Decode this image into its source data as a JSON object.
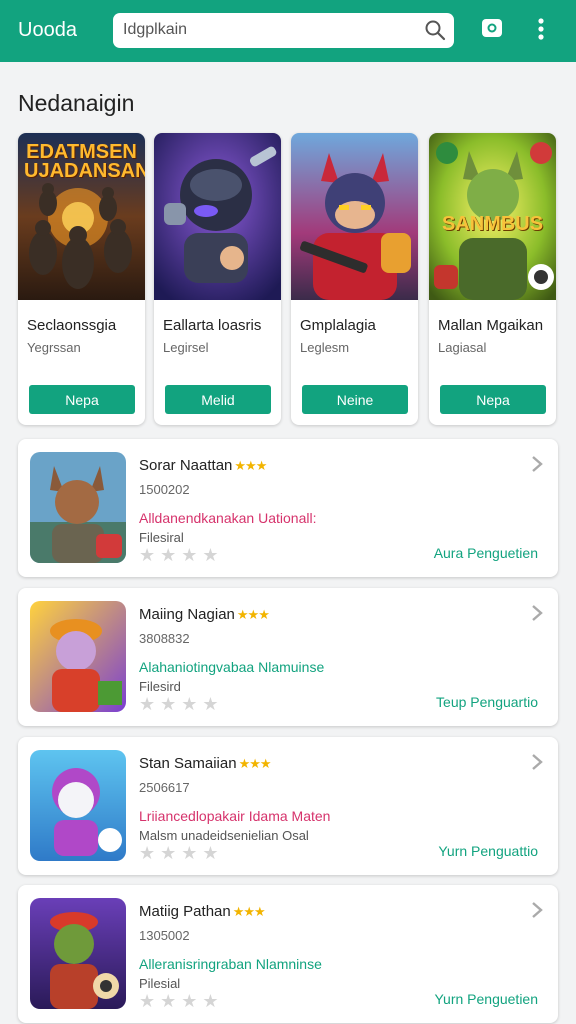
{
  "header": {
    "brand": "Uooda",
    "search_value": "Idgplkain",
    "icons": [
      "search-icon",
      "camera-icon",
      "more-vert-icon"
    ],
    "accent_color": "#12a37f"
  },
  "section_title": "Nedanaigin",
  "featured": [
    {
      "poster_text": "EDATMSEN UJADANSAN",
      "title": "Seclaonssgia",
      "subtitle": "Yegrssan",
      "button": "Nepa"
    },
    {
      "title": "Eallarta loasris",
      "subtitle": "Legirsel",
      "button": "Melid"
    },
    {
      "title": "Gmplalagia",
      "subtitle": "Leglesm",
      "button": "Neine"
    },
    {
      "poster_text": "SANMBUS",
      "title": "Mallan Mgaikan",
      "subtitle": "Lagiasal",
      "button": "Nepa"
    }
  ],
  "list": [
    {
      "title": "Sorar Naattan",
      "stars_text": "★★★",
      "number": "1500202",
      "description": "Alldanendkanakan Uationall:",
      "description_color": "#d6336c",
      "sub": "Filesiral",
      "rating_text": "★★★★",
      "action": "Aura Penguetien"
    },
    {
      "title": "Maiing Nagian",
      "stars_text": "★★★",
      "number": "3808832",
      "description": "Alahaniotingvabaa Nlamuinse",
      "description_color": "#12a37f",
      "sub": "Filesird",
      "rating_text": "★★★★",
      "action": "Teup Penguartio"
    },
    {
      "title": "Stan Samaiian",
      "stars_text": "★★★",
      "number": "2506617",
      "description": "Lriiancedlopakair Idama Maten",
      "description_color": "#d6336c",
      "sub": "Malsm unadeidsenielian Osal",
      "rating_text": "★★★★",
      "action": "Yurn Penguattio"
    },
    {
      "title": "Matiig Pathan",
      "stars_text": "★★★",
      "number": "1305002",
      "description": "Alleranisringraban Nlamninse",
      "description_color": "#12a37f",
      "sub": "Pilesial",
      "rating_text": "★★★★",
      "action": "Yurn Penguetien"
    }
  ]
}
